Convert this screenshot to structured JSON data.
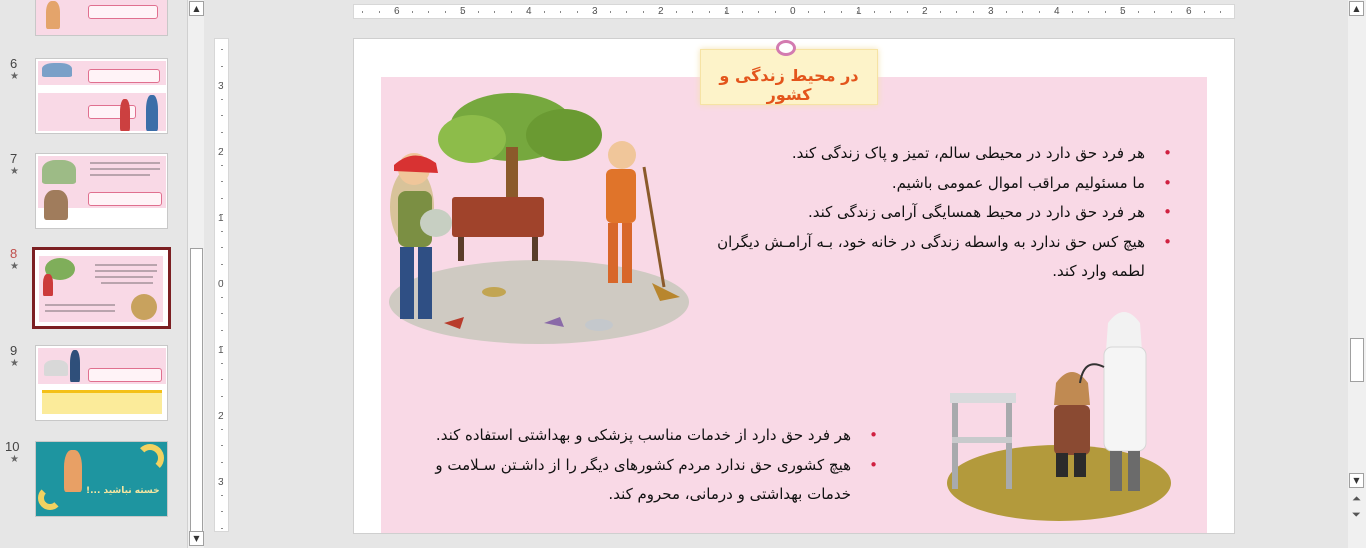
{
  "thumbnails": [
    {
      "number": "6",
      "star": "★"
    },
    {
      "number": "7",
      "star": "★"
    },
    {
      "number": "8",
      "star": "★"
    },
    {
      "number": "9",
      "star": "★"
    },
    {
      "number": "10",
      "star": "★",
      "caption": "خسته نباشید ...!"
    }
  ],
  "ruler": {
    "h_labels": [
      "6",
      "5",
      "4",
      "3",
      "2",
      "1",
      "0",
      "1",
      "2",
      "3",
      "4",
      "5",
      "6"
    ],
    "v_labels": [
      "3",
      "2",
      "1",
      "0",
      "1",
      "2",
      "3"
    ]
  },
  "slide": {
    "title": "در محیط زندگی و کشور",
    "bullets_top": [
      "هر فرد حق دارد در محیطی سالم، تمیز و پاک زندگی کند.",
      "ما مسئولیم مراقب اموال عمومی باشیم.",
      "هر فرد حق دارد در محیط همسایگی آرامی زندگی کند.",
      "هیچ کس حق ندارد به واسطه زندگی در خانه خود، بـه آرامـش دیگران لطمه وارد کند."
    ],
    "bullets_bottom": [
      "هر فرد حق دارد از خدمات مناسب پزشکی و بهداشتی استفاده کند.",
      "هیچ کشوری حق ندارد مردم کشورهای دیگر را از داشـتن سـلامت و خدمات بهداشتی و درمانی، محروم کند."
    ]
  },
  "colors": {
    "accent": "#c0504d",
    "selected_border": "#7b1f22",
    "slide_pink": "#f9d9e6",
    "title_orange": "#e3551c"
  }
}
